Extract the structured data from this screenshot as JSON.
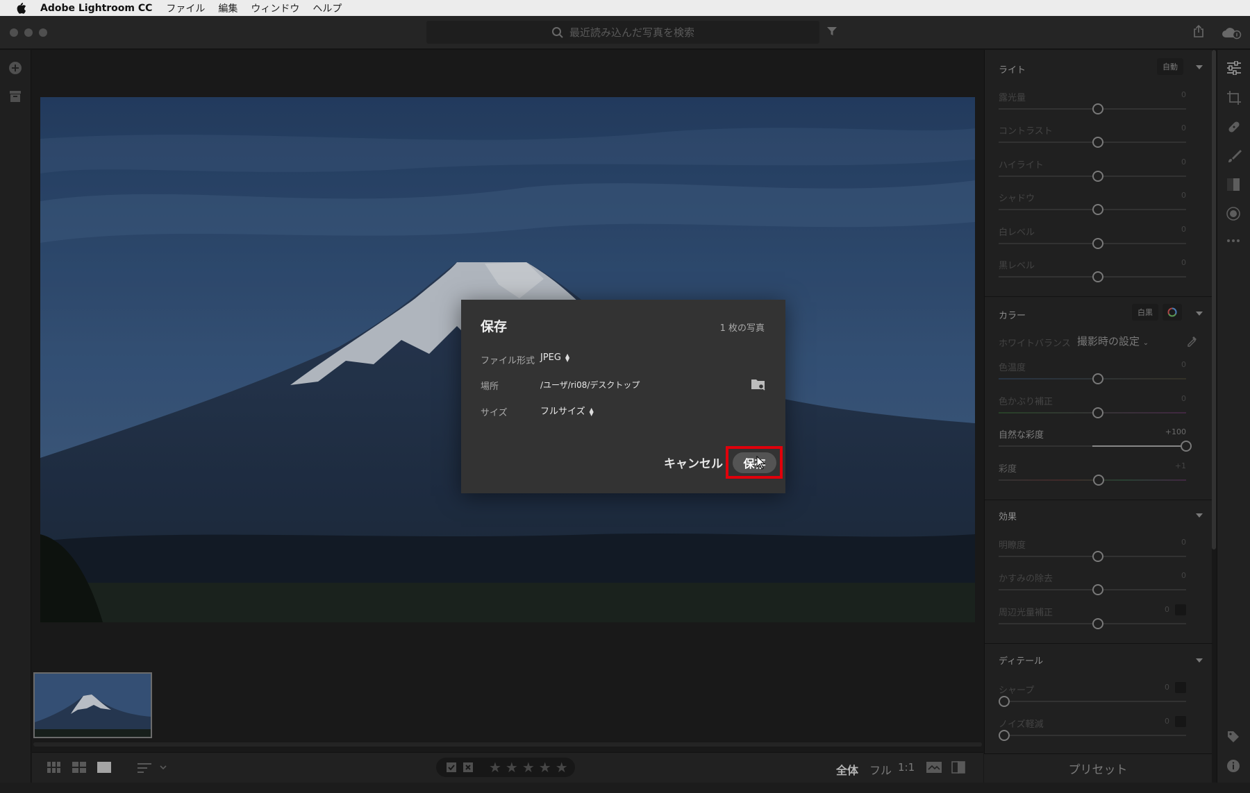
{
  "menubar": {
    "app_name": "Adobe Lightroom CC",
    "items": [
      "ファイル",
      "編集",
      "ウィンドウ",
      "ヘルプ"
    ]
  },
  "search": {
    "placeholder": "最近読み込んだ写真を検索"
  },
  "bottombar": {
    "view_all": "全体",
    "view_full": "フル",
    "view_1to1": "1:1",
    "stars": "★★★★★"
  },
  "panel": {
    "light": {
      "title": "ライト",
      "auto_label": "自動",
      "sliders": [
        {
          "label": "露光量",
          "value": "0"
        },
        {
          "label": "コントラスト",
          "value": "0"
        },
        {
          "label": "ハイライト",
          "value": "0"
        },
        {
          "label": "シャドウ",
          "value": "0"
        },
        {
          "label": "白レベル",
          "value": "0"
        },
        {
          "label": "黒レベル",
          "value": "0"
        }
      ]
    },
    "color": {
      "title": "カラー",
      "bw_label": "白黒",
      "wb_label": "ホワイトバランス",
      "wb_value": "撮影時の設定",
      "sliders": [
        {
          "label": "色温度",
          "value": "0"
        },
        {
          "label": "色かぶり補正",
          "value": "0"
        },
        {
          "label": "自然な彩度",
          "value": "+100"
        },
        {
          "label": "彩度",
          "value": "+1"
        }
      ]
    },
    "effects": {
      "title": "効果",
      "sliders": [
        {
          "label": "明瞭度",
          "value": "0"
        },
        {
          "label": "かすみの除去",
          "value": "0"
        },
        {
          "label": "周辺光量補正",
          "value": "0"
        }
      ]
    },
    "detail": {
      "title": "ディテール",
      "sliders": [
        {
          "label": "シャープ",
          "value": "0"
        },
        {
          "label": "ノイズ軽減",
          "value": "0"
        }
      ]
    },
    "presets_label": "プリセット"
  },
  "dialog": {
    "title": "保存",
    "count": "1 枚の写真",
    "format_label": "ファイル形式",
    "format_value": "JPEG",
    "location_label": "場所",
    "location_value": "/ユーザ/ri08/デスクトップ",
    "size_label": "サイズ",
    "size_value": "フルサイズ",
    "cancel_label": "キャンセル",
    "save_label": "保存"
  },
  "colors": {
    "highlight": "#e0000b",
    "panel_bg": "#252525",
    "dialog_bg": "#333333"
  }
}
